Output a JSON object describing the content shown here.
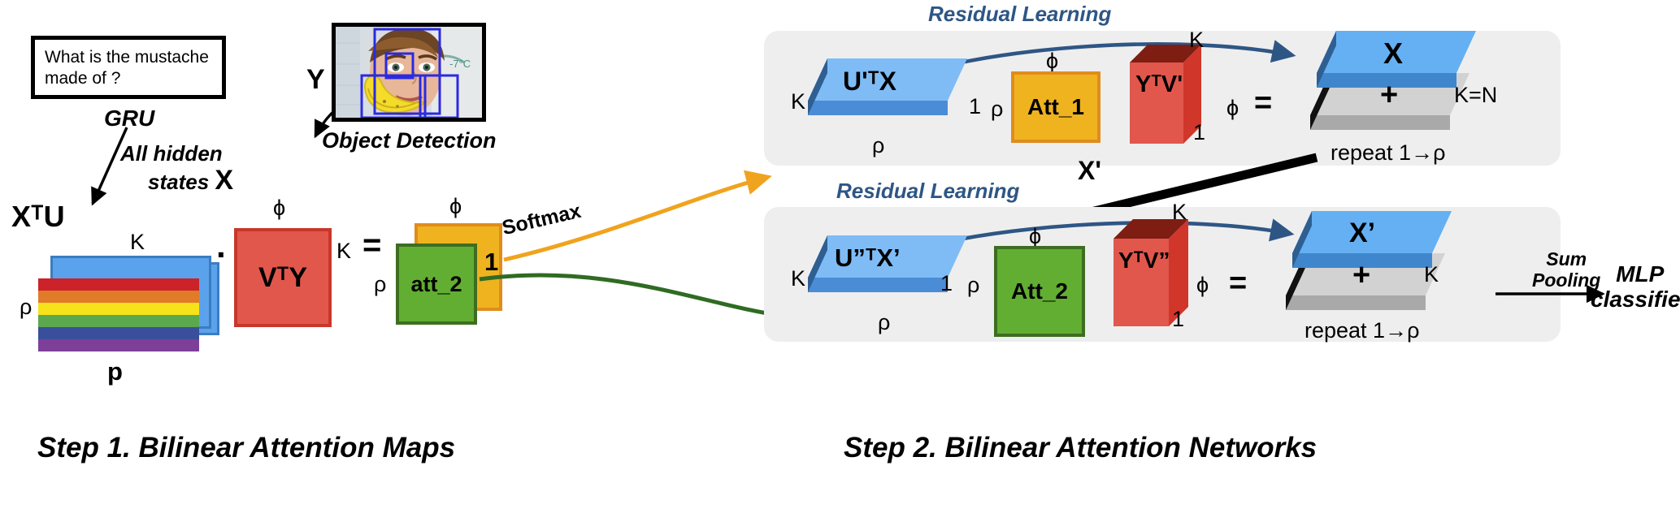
{
  "figure": {
    "step1_caption": "Step 1. Bilinear Attention Maps",
    "step2_caption": "Step 2. Bilinear Attention Networks"
  },
  "step1": {
    "question": "What is the mustache made of ?",
    "gru_label": "GRU",
    "hidden_states_label": "All hidden\nstates",
    "hidden_states_symbol": "X",
    "xtu_label": "XᵀU",
    "y_label": "Y",
    "object_detection_label": "Object Detection",
    "stack_top_dim": "K",
    "stack_left_dim": "ρ",
    "stack_bottom_dim": "p",
    "dot_operator": "·",
    "vty_label": "VᵀY",
    "vty_top_dim": "ϕ",
    "vty_right_dim": "K",
    "equals_operator": "=",
    "att2_label": "att_2",
    "att2_left_dim": "ρ",
    "att1_top_dim": "ϕ",
    "att1_right_dim": "1",
    "softmax_label": "Softmax"
  },
  "step2": {
    "top_panel": {
      "residual_label": "Residual Learning",
      "ux_label": "U'ᵀX",
      "ux_left_dim": "K",
      "ux_bottom_dim": "ρ",
      "ux_right_dim": "1",
      "att_left_dim": "ρ",
      "att_label": "Att_1",
      "att_top_dim": "ϕ",
      "yv_label": "YᵀV'",
      "yv_top_dim": "K",
      "yv_bottom_dim": "1",
      "yv_right_dim": "ϕ",
      "equals": "=",
      "out_label": "X",
      "plus": "+",
      "out_right_dim": "K=N",
      "repeat_label": "repeat 1→ρ"
    },
    "bottom_panel": {
      "residual_label": "Residual Learning",
      "ux_label": "U”ᵀX’",
      "ux_left_dim": "K",
      "ux_bottom_dim": "ρ",
      "ux_right_dim": "1",
      "att_left_dim": "ρ",
      "att_label": "Att_2",
      "att_top_dim": "ϕ",
      "yv_label": "YᵀV”",
      "yv_top_dim": "K",
      "yv_bottom_dim": "1",
      "yv_right_dim": "ϕ",
      "equals": "=",
      "out_label": "X’",
      "plus": "+",
      "out_right_dim": "K",
      "repeat_label": "repeat 1→ρ"
    },
    "x_prime_arrow_label": "X'",
    "sum_pooling_label": "Sum\nPooling",
    "mlp_label": "MLP\nclassifier"
  },
  "colors": {
    "blue_face": "#5ba2ec",
    "blue_side": "#3a6ea5",
    "blue_top_light": "#8ec5f5",
    "red": "#e2574c",
    "red_dark": "#a8281c",
    "red_side": "#d0362a",
    "orange": "#efb31f",
    "green": "#62ae32",
    "grey_panel": "#efeeee",
    "residual_blue": "#2e5685",
    "softmax_orange": "#f0a31e",
    "softmax_green": "#2f6b23",
    "grey_plate": "#d2d2d2"
  },
  "rainbow_bands": [
    "#cc2229",
    "#e07b28",
    "#f7e319",
    "#5ba84f",
    "#3a4f9b",
    "#7e3f98"
  ]
}
